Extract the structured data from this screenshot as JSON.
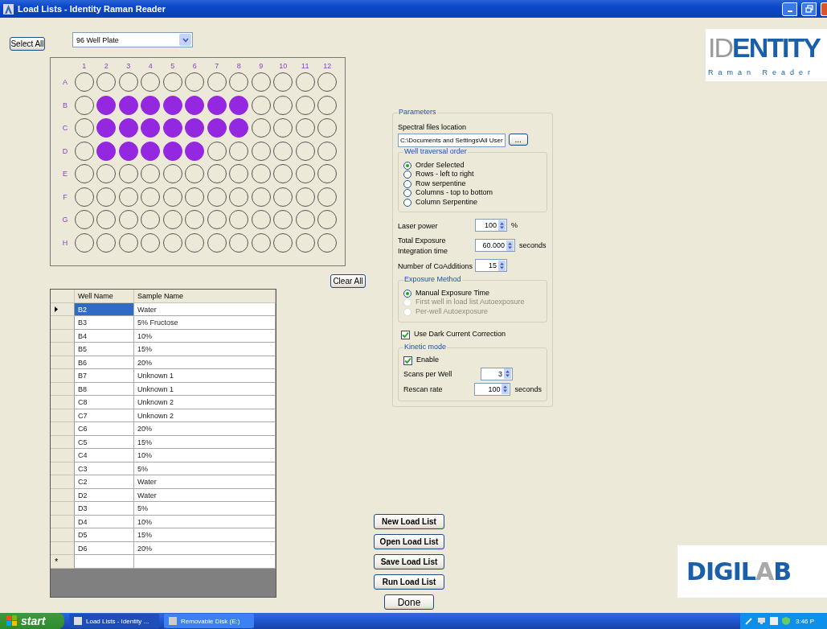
{
  "window": {
    "title": "Load Lists - Identity Raman Reader"
  },
  "select_all_button": "Select All",
  "plate_type": {
    "value": "96 Well Plate"
  },
  "plate": {
    "columns": [
      "1",
      "2",
      "3",
      "4",
      "5",
      "6",
      "7",
      "8",
      "9",
      "10",
      "11",
      "12"
    ],
    "rows": [
      {
        "label": "A",
        "wells": [
          {
            "selected": false
          },
          {
            "selected": false
          },
          {
            "selected": false
          },
          {
            "selected": false
          },
          {
            "selected": false
          },
          {
            "selected": false
          },
          {
            "selected": false
          },
          {
            "selected": false
          },
          {
            "selected": false
          },
          {
            "selected": false
          },
          {
            "selected": false
          },
          {
            "selected": false
          }
        ]
      },
      {
        "label": "B",
        "wells": [
          {
            "selected": false
          },
          {
            "selected": true
          },
          {
            "selected": true
          },
          {
            "selected": true
          },
          {
            "selected": true
          },
          {
            "selected": true
          },
          {
            "selected": true
          },
          {
            "selected": true
          },
          {
            "selected": false
          },
          {
            "selected": false
          },
          {
            "selected": false
          },
          {
            "selected": false
          }
        ]
      },
      {
        "label": "C",
        "wells": [
          {
            "selected": false
          },
          {
            "selected": true
          },
          {
            "selected": true
          },
          {
            "selected": true
          },
          {
            "selected": true
          },
          {
            "selected": true
          },
          {
            "selected": true
          },
          {
            "selected": true
          },
          {
            "selected": false
          },
          {
            "selected": false
          },
          {
            "selected": false
          },
          {
            "selected": false
          }
        ]
      },
      {
        "label": "D",
        "wells": [
          {
            "selected": false
          },
          {
            "selected": true
          },
          {
            "selected": true
          },
          {
            "selected": true
          },
          {
            "selected": true
          },
          {
            "selected": true
          },
          {
            "selected": false
          },
          {
            "selected": false
          },
          {
            "selected": false
          },
          {
            "selected": false
          },
          {
            "selected": false
          },
          {
            "selected": false
          }
        ]
      },
      {
        "label": "E",
        "wells": [
          {
            "selected": false
          },
          {
            "selected": false
          },
          {
            "selected": false
          },
          {
            "selected": false
          },
          {
            "selected": false
          },
          {
            "selected": false
          },
          {
            "selected": false
          },
          {
            "selected": false
          },
          {
            "selected": false
          },
          {
            "selected": false
          },
          {
            "selected": false
          },
          {
            "selected": false
          }
        ]
      },
      {
        "label": "F",
        "wells": [
          {
            "selected": false
          },
          {
            "selected": false
          },
          {
            "selected": false
          },
          {
            "selected": false
          },
          {
            "selected": false
          },
          {
            "selected": false
          },
          {
            "selected": false
          },
          {
            "selected": false
          },
          {
            "selected": false
          },
          {
            "selected": false
          },
          {
            "selected": false
          },
          {
            "selected": false
          }
        ]
      },
      {
        "label": "G",
        "wells": [
          {
            "selected": false
          },
          {
            "selected": false
          },
          {
            "selected": false
          },
          {
            "selected": false
          },
          {
            "selected": false
          },
          {
            "selected": false
          },
          {
            "selected": false
          },
          {
            "selected": false
          },
          {
            "selected": false
          },
          {
            "selected": false
          },
          {
            "selected": false
          },
          {
            "selected": false
          }
        ]
      },
      {
        "label": "H",
        "wells": [
          {
            "selected": false
          },
          {
            "selected": false
          },
          {
            "selected": false
          },
          {
            "selected": false
          },
          {
            "selected": false
          },
          {
            "selected": false
          },
          {
            "selected": false
          },
          {
            "selected": false
          },
          {
            "selected": false
          },
          {
            "selected": false
          },
          {
            "selected": false
          },
          {
            "selected": false
          }
        ]
      }
    ]
  },
  "clear_all_button": "Clear All",
  "table": {
    "columns": [
      "Well Name",
      "Sample Name"
    ],
    "rows": [
      {
        "well": "B2",
        "sample": "Water",
        "selected": true
      },
      {
        "well": "B3",
        "sample": "5% Fructose",
        "selected": false
      },
      {
        "well": "B4",
        "sample": "10%",
        "selected": false
      },
      {
        "well": "B5",
        "sample": "15%",
        "selected": false
      },
      {
        "well": "B6",
        "sample": "20%",
        "selected": false
      },
      {
        "well": "B7",
        "sample": "Unknown 1",
        "selected": false
      },
      {
        "well": "B8",
        "sample": "Unknown 1",
        "selected": false
      },
      {
        "well": "C8",
        "sample": "Unknown 2",
        "selected": false
      },
      {
        "well": "C7",
        "sample": "Unknown 2",
        "selected": false
      },
      {
        "well": "C6",
        "sample": "20%",
        "selected": false
      },
      {
        "well": "C5",
        "sample": "15%",
        "selected": false
      },
      {
        "well": "C4",
        "sample": "10%",
        "selected": false
      },
      {
        "well": "C3",
        "sample": "5%",
        "selected": false
      },
      {
        "well": "C2",
        "sample": "Water",
        "selected": false
      },
      {
        "well": "D2",
        "sample": "Water",
        "selected": false
      },
      {
        "well": "D3",
        "sample": "5%",
        "selected": false
      },
      {
        "well": "D4",
        "sample": "10%",
        "selected": false
      },
      {
        "well": "D5",
        "sample": "15%",
        "selected": false
      },
      {
        "well": "D6",
        "sample": "20%",
        "selected": false
      }
    ],
    "new_row_marker": "*"
  },
  "parameters": {
    "title": "Parameters",
    "files_location": {
      "label": "Spectral files location",
      "value": "C:\\Documents and Settings\\All User",
      "browse_button": "..."
    },
    "traversal": {
      "title": "Well traversal order",
      "options": [
        {
          "label": "Order Selected",
          "selected": true
        },
        {
          "label": "Rows - left to right",
          "selected": false
        },
        {
          "label": "Row serpentine",
          "selected": false
        },
        {
          "label": "Columns - top to bottom",
          "selected": false
        },
        {
          "label": "Column Serpentine",
          "selected": false
        }
      ]
    },
    "fields": [
      {
        "label": "Laser power",
        "value": "100",
        "unit": "%"
      },
      {
        "label": "Total Exposure\nIntegration time",
        "value": "60.000",
        "unit": "seconds"
      },
      {
        "label": "Number of CoAdditions",
        "value": "15"
      }
    ],
    "exposure": {
      "title": "Exposure Method",
      "options": [
        {
          "label": "Manual Exposure Time",
          "selected": true,
          "disabled": false
        },
        {
          "label": "First well in load list Autoexposure",
          "selected": false,
          "disabled": true
        },
        {
          "label": "Per-well Autoexposure",
          "selected": false,
          "disabled": true
        }
      ]
    },
    "dark_current": {
      "label": "Use Dark Current Correction",
      "checked": true
    },
    "kinetic": {
      "title": "Kinetic mode",
      "enable": {
        "label": "Enable",
        "checked": true
      },
      "fields": [
        {
          "label": "Scans per Well",
          "value": "3"
        },
        {
          "label": "Rescan rate",
          "value": "100",
          "unit": "seconds"
        }
      ]
    }
  },
  "actions": [
    "New Load List",
    "Open Load List",
    "Save Load List",
    "Run Load List"
  ],
  "done_button": "Done",
  "logos": {
    "identity": {
      "parts": [
        {
          "text": "ID",
          "color": "#9a9a9a"
        },
        {
          "text": "ENTITY",
          "color": "#1a5fa8"
        }
      ],
      "subtitle": "Raman Reader"
    },
    "digilab": {
      "parts": [
        {
          "text": "DIGIL",
          "color": "#1a5fa8"
        },
        {
          "text": "A",
          "color": "#a8a8a8"
        },
        {
          "text": "B",
          "color": "#1a5fa8"
        }
      ]
    }
  },
  "taskbar": {
    "start": "start",
    "tasks": [
      {
        "label": "Load Lists - Identity ...",
        "selected": true
      },
      {
        "label": "Removable Disk (E:)",
        "selected": false
      }
    ],
    "clock": "3:46 P"
  }
}
